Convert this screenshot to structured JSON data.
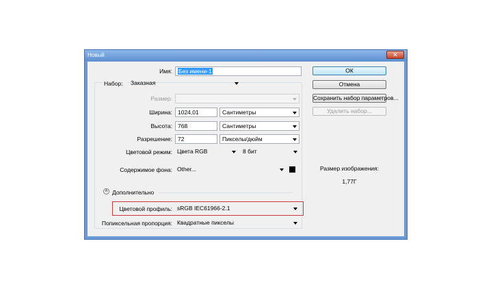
{
  "window": {
    "title": "Новый",
    "close_glyph": "✕"
  },
  "name_field": {
    "label": "Имя:",
    "value": "Без имени-1"
  },
  "preset": {
    "label": "Набор:",
    "value": "Заказная"
  },
  "size": {
    "label": "Размер:",
    "value": ""
  },
  "width": {
    "label": "Ширина:",
    "value": "1024,01",
    "unit": "Сантиметры"
  },
  "height": {
    "label": "Высота:",
    "value": "768",
    "unit": "Сантиметры"
  },
  "resolution": {
    "label": "Разрешение:",
    "value": "72",
    "unit": "Пикселы/дюйм"
  },
  "color_mode": {
    "label": "Цветовой режим:",
    "value": "Цвета RGB",
    "depth": "8 бит"
  },
  "background": {
    "label": "Содержимое фона:",
    "value": "Other...",
    "swatch_color": "#000000"
  },
  "advanced": {
    "label": "Дополнительно",
    "icon": "chevron-up-icon"
  },
  "color_profile": {
    "label": "Цветовой профиль:",
    "value": "sRGB IEC61966-2.1"
  },
  "pixel_aspect": {
    "label": "Попиксельная пропорция:",
    "value": "Квадратные пикселы"
  },
  "buttons": {
    "ok": "ОК",
    "cancel": "Отмена",
    "save_preset": "Сохранить набор параметров...",
    "delete_preset": "Удалить набор..."
  },
  "image_size": {
    "label": "Размер изображения:",
    "value": "1,77Г"
  },
  "colors": {
    "title_bar": "#6a9bd8",
    "highlight": "#d0373d"
  }
}
